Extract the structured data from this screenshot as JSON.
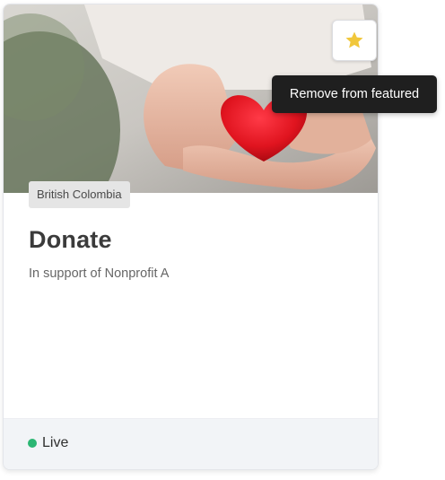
{
  "card": {
    "region_tag": "British Colombia",
    "title": "Donate",
    "subtitle": "In support of Nonprofit A",
    "status": {
      "label": "Live",
      "color": "#2bb673"
    }
  },
  "featured": {
    "icon": "star-icon",
    "color": "#f1c73b",
    "tooltip": "Remove from featured"
  }
}
